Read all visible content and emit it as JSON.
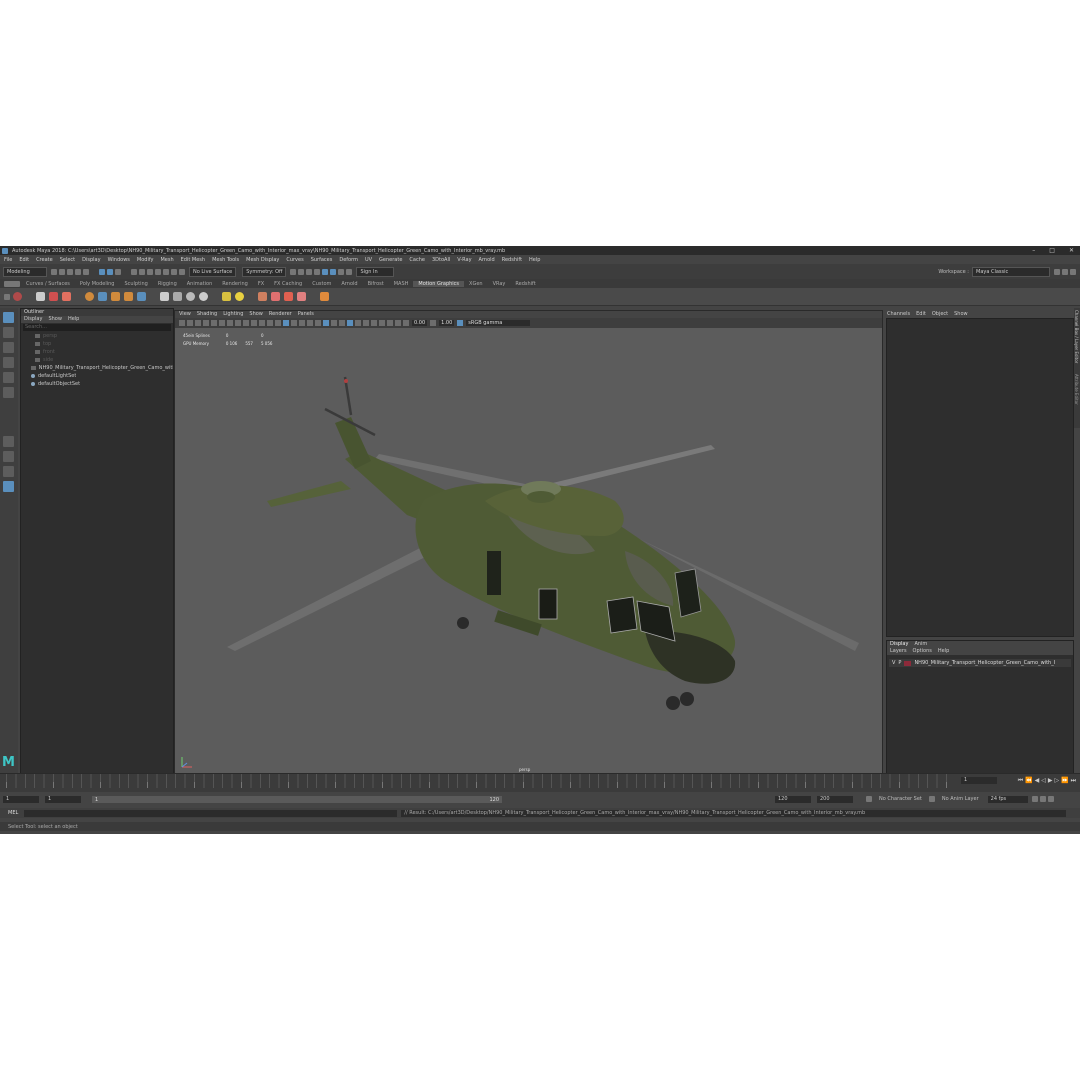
{
  "window": {
    "title": "Autodesk Maya 2018: C:\\Users\\art3D\\Desktop\\NH90_Military_Transport_Helicopter_Green_Camo_with_Interior_max_vray\\NH90_Military_Transport_Helicopter_Green_Camo_with_Interior_mb_vray.mb",
    "minimize": "–",
    "maximize": "□",
    "close": "✕"
  },
  "menubar": [
    "File",
    "Edit",
    "Create",
    "Select",
    "Display",
    "Windows",
    "Modify",
    "Mesh",
    "Edit Mesh",
    "Mesh Tools",
    "Mesh Display",
    "Curves",
    "Surfaces",
    "Deform",
    "UV",
    "Generate",
    "Cache",
    "3DtoAll",
    "V-Ray",
    "Arnold",
    "Redshift",
    "Help"
  ],
  "statusline": {
    "mode": "Modeling",
    "live_surface": "No Live Surface",
    "symmetry": "Symmetry: Off",
    "sign_in": "Sign In",
    "workspace_label": "Workspace :",
    "workspace": "Maya Classic"
  },
  "shelf_tabs": [
    "Curves / Surfaces",
    "Poly Modeling",
    "Sculpting",
    "Rigging",
    "Animation",
    "Rendering",
    "FX",
    "FX Caching",
    "Custom",
    "Arnold",
    "Bifrost",
    "MASH",
    "Motion Graphics",
    "XGen",
    "VRay",
    "Redshift"
  ],
  "active_shelf_tab": "Motion Graphics",
  "outliner": {
    "title": "Outliner",
    "menu": [
      "Display",
      "Show",
      "Help"
    ],
    "search_placeholder": "Search...",
    "items": [
      {
        "label": "persp",
        "dim": true
      },
      {
        "label": "top",
        "dim": true
      },
      {
        "label": "front",
        "dim": true
      },
      {
        "label": "side",
        "dim": true
      },
      {
        "label": "NH90_Military_Transport_Helicopter_Green_Camo_with_I",
        "dim": false
      },
      {
        "label": "defaultLightSet",
        "dim": false
      },
      {
        "label": "defaultObjectSet",
        "dim": false
      }
    ]
  },
  "viewport": {
    "menu": [
      "View",
      "Shading",
      "Lighting",
      "Show",
      "Renderer",
      "Panels"
    ],
    "exposure": "0.00",
    "gamma": "1.00",
    "colorspace": "sRGB gamma",
    "hud": {
      "row1_label": "45ein Splines",
      "row1_v1": "0",
      "row1_v2": "0",
      "row2_label": "GPU Memory",
      "row2_v1": "0 106",
      "row2_v2": "557",
      "row2_v3": "5 056"
    },
    "camera": "persp"
  },
  "channel_box": {
    "menu": [
      "Channels",
      "Edit",
      "Object",
      "Show"
    ]
  },
  "layer_editor": {
    "tabs": [
      "Display",
      "Anim"
    ],
    "menu": [
      "Layers",
      "Options",
      "Help"
    ],
    "layer_v": "V",
    "layer_p": "P",
    "layer_name": "NH90_Military_Transport_Helicopter_Green_Camo_with_I",
    "layer_color": "#8c2a3a"
  },
  "side_tab": "Channel Box / Layer Editor",
  "side_tab2": "Attribute Editor",
  "time": {
    "current_frame": "1",
    "start": "1",
    "range_start": "1",
    "range_end": "120",
    "end": "120",
    "anim_end": "200",
    "character_set": "No Character Set",
    "anim_layer": "No Anim Layer",
    "fps": "24 fps",
    "frame_field": "1"
  },
  "cmdline": {
    "lang": "MEL",
    "result": "// Result: C:/Users/art3D/Desktop/NH90_Military_Transport_Helicopter_Green_Camo_with_Interior_max_vray/NH90_Military_Transport_Helicopter_Green_Camo_with_Interior_mb_vray.mb"
  },
  "help_line": "Select Tool: select an object"
}
